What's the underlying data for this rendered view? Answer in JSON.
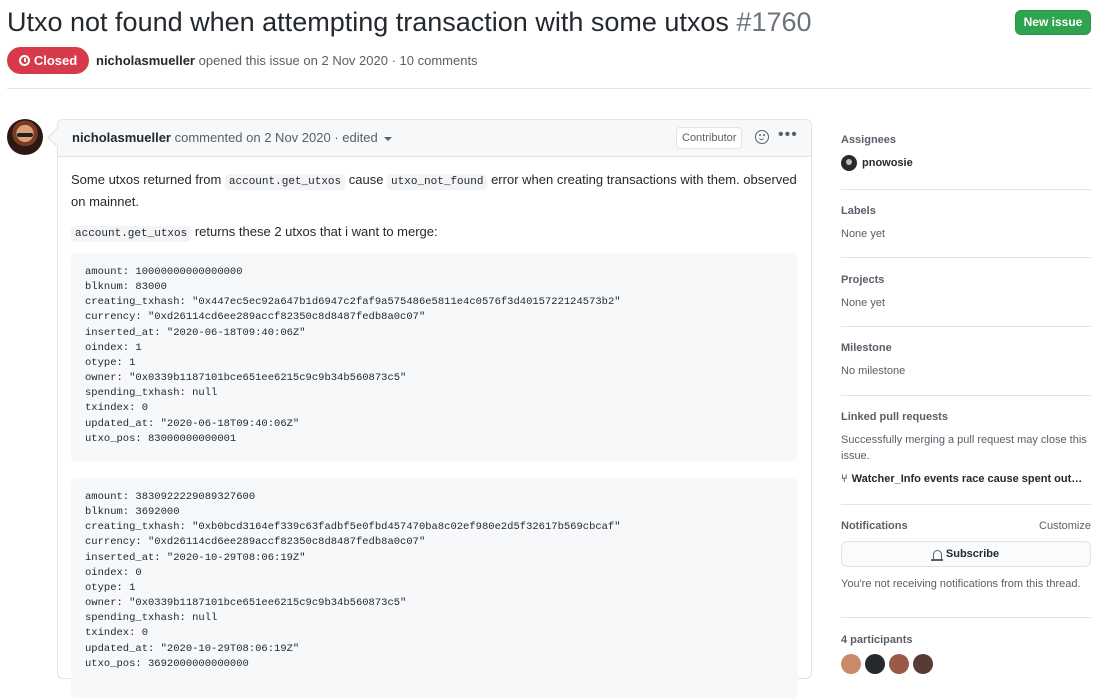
{
  "issue": {
    "title": "Utxo not found when attempting transaction with some utxos",
    "number": "#1760",
    "state": "Closed",
    "author": "nicholasmueller",
    "opened_text": "opened this issue on 2 Nov 2020 · 10 comments",
    "new_issue_label": "New issue"
  },
  "comment": {
    "author": "nicholasmueller",
    "meta": "commented on 2 Nov 2020 · edited",
    "role": "Contributor",
    "para1": {
      "t1": "Some utxos returned from ",
      "c1": "account.get_utxos",
      "t2": " cause ",
      "c2": "utxo_not_found",
      "t3": " error when creating transactions with them. observed on mainnet."
    },
    "para2": {
      "c1": "account.get_utxos",
      "t1": " returns these 2 utxos that i want to merge:"
    },
    "code1": "amount: 10000000000000000\nblknum: 83000\ncreating_txhash: \"0x447ec5ec92a647b1d6947c2faf9a575486e5811e4c0576f3d4015722124573b2\"\ncurrency: \"0xd26114cd6ee289accf82350c8d8487fedb8a0c07\"\ninserted_at: \"2020-06-18T09:40:06Z\"\noindex: 1\notype: 1\nowner: \"0x0339b1187101bce651ee6215c9c9b34b560873c5\"\nspending_txhash: null\ntxindex: 0\nupdated_at: \"2020-06-18T09:40:06Z\"\nutxo_pos: 83000000000001",
    "code2": "amount: 3830922229089327600\nblknum: 3692000\ncreating_txhash: \"0xb0bcd3164ef339c63fadbf5e0fbd457470ba8c02ef980e2d5f32617b569cbcaf\"\ncurrency: \"0xd26114cd6ee289accf82350c8d8487fedb8a0c07\"\ninserted_at: \"2020-10-29T08:06:19Z\"\noindex: 0\notype: 1\nowner: \"0x0339b1187101bce651ee6215c9c9b34b560873c5\"\nspending_txhash: null\ntxindex: 0\nupdated_at: \"2020-10-29T08:06:19Z\"\nutxo_pos: 3692000000000000"
  },
  "sidebar": {
    "assignees": {
      "heading": "Assignees",
      "name": "pnowosie"
    },
    "labels": {
      "heading": "Labels",
      "value": "None yet"
    },
    "projects": {
      "heading": "Projects",
      "value": "None yet"
    },
    "milestone": {
      "heading": "Milestone",
      "value": "No milestone"
    },
    "linked_prs": {
      "heading": "Linked pull requests",
      "description": "Successfully merging a pull request may close this issue.",
      "pr_title": "Watcher_Info events race cause spent out…"
    },
    "notifications": {
      "heading": "Notifications",
      "customize": "Customize",
      "subscribe_label": "Subscribe",
      "status": "You're not receiving notifications from this thread."
    },
    "participants": {
      "heading": "4 participants"
    }
  }
}
